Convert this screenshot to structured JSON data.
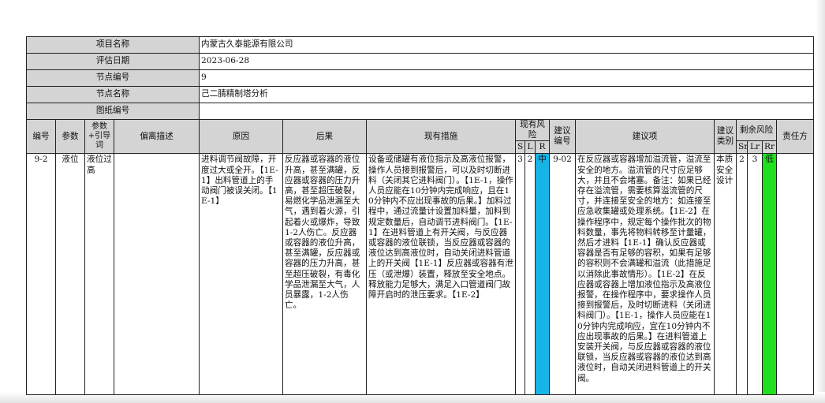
{
  "project": {
    "name_label": "项目名称",
    "name_value": "内蒙古久泰能源有限公司",
    "date_label": "评估日期",
    "date_value": "2023-06-28",
    "node_no_label": "节点编号",
    "node_no_value": "9",
    "node_name_label": "节点名称",
    "node_name_value": "己二腈精制塔分析",
    "drawing_label": "图纸编号",
    "drawing_value": ""
  },
  "columns": {
    "id": "编号",
    "param": "参数",
    "guide": "参数+引导词",
    "deviation": "偏离描述",
    "cause": "原因",
    "consequence": "后果",
    "measures": "现有措施",
    "current_risk": "现有风险",
    "s": "S",
    "l": "L",
    "r": "R",
    "rec_id": "建议编号",
    "recommendation": "建议项",
    "rec_type": "建议类别",
    "residual_risk": "剩余风险",
    "sr": "Sr",
    "lr": "Lr",
    "rr": "Rr",
    "owner": "责任方"
  },
  "rows": [
    {
      "id": "9-2",
      "param": "液位",
      "guide": "液位过高",
      "deviation": "",
      "cause": "进料调节阀故障，开度过大或全开。【1E-1】出料管道上的手动阀门被误关闭。【1E-1】",
      "consequence": "反应器或容器的液位升高，甚至满罐，反应器或容器的压力升高，甚至超压破裂，易燃化学品泄漏至大气，遇到着火源，引起着火或爆炸，导致1-2人伤亡。反应器或容器的液位升高，甚至满罐，反应器或容器的压力升高，甚至超压破裂，有毒化学品泄漏至大气，人员暴露，1-2人伤亡。",
      "measures": "设备或储罐有液位指示及高液位报警，操作人员接到报警后，可以及时切断进料（关闭其它进料阀门）。【1E-1，操作人员应能在10分钟内完成响应，且在10分钟内不应出现事故的后果。】加料过程中，通过流量计设置加料量，加料到规定数量后，自动调节进料阀门。【1E-1】在进料管道上有开关阀，与反应器或容器的液位联锁，当反应器或容器的液位达到高液位时，自动关闭进料管道上的开关阀【1E-1】反应器或容器有泄压（或泄爆）装置，释放至安全地点。释放能力足够大，满足入口管道阀门故障开启时的泄压要求。【1E-2】",
      "s": "3",
      "l": "2",
      "r": "中",
      "rec_id": "9-02",
      "recommendation": "在反应器或容器增加溢流管，溢流至安全的地方。溢流管的尺寸应足够大，并且不会堵塞。备注：如果已经存在溢流管，需要核算溢流管的尺寸，并连接至安全的地方：如连接至应急收集罐或处理系统。【1E-2】在操作程序中，规定每个操作批次的物料数量，事先将物料转移至计量罐，然后才进料【1E-1】确认反应器或容器是否有足够的容积，如果有足够的容积则不会满罐和溢流（此措施足以消除此事故情形）。【1E-2】在反应器或容器上增加液位指示及高液位报警，在操作程序中，要求操作人员接到报警后，及时切断进料（关闭进料阀门）。【1E-1，操作人员应能在10分钟内完成响应，宜在10分钟内不应出现事故的后果。】在进料管道上安装开关阀，与反应器或容器的液位联锁，当反应器或容器的液位达到高液位时，自动关闭进料管道上的开关阀。",
      "rec_type": "本质安全设计",
      "sr": "2",
      "lr": "3",
      "rr": "低",
      "owner": ""
    }
  ],
  "colors": {
    "header_bg": "#d4d4d4",
    "risk_medium": "#18b4e8",
    "risk_low": "#1fe01f"
  }
}
